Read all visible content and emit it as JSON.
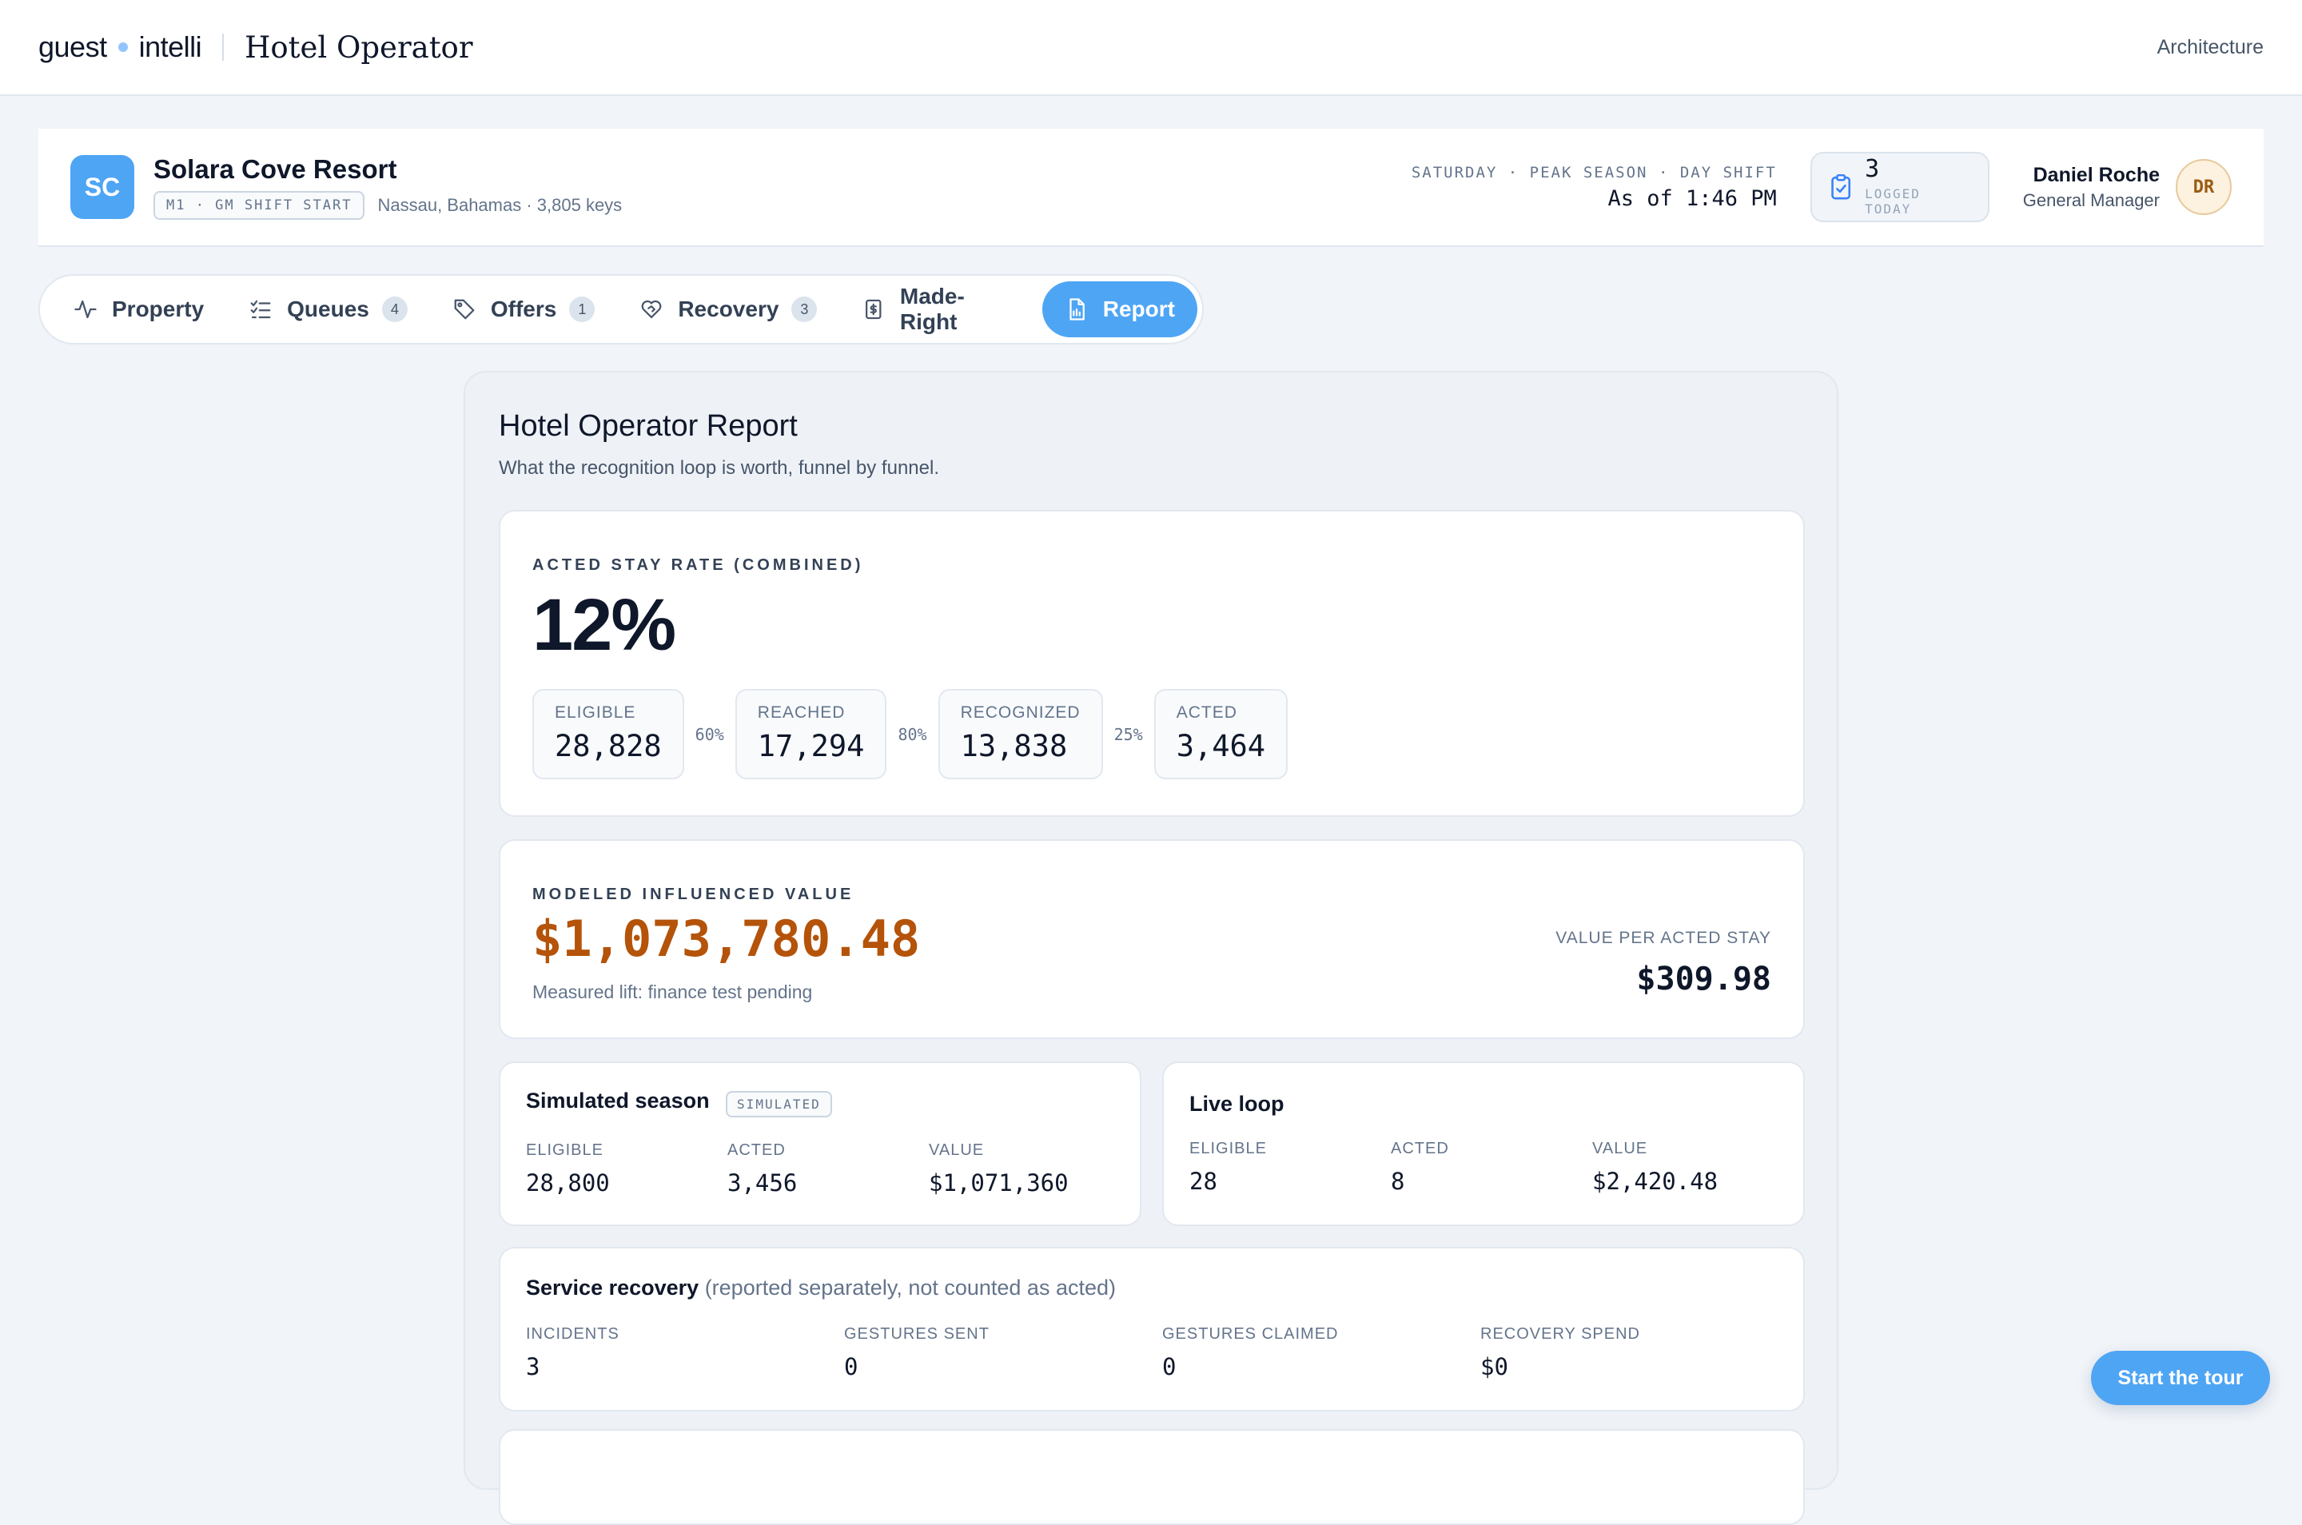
{
  "brand": {
    "part1": "guest",
    "part2": "intelli",
    "product": "Hotel Operator"
  },
  "top_nav": {
    "architecture": "Architecture"
  },
  "property": {
    "initials": "SC",
    "name": "Solara Cove Resort",
    "shift_badge": "M1 · GM SHIFT START",
    "location": "Nassau, Bahamas · 3,805 keys",
    "shift_line": "SATURDAY · PEAK SEASON · DAY SHIFT",
    "as_of": "As of 1:46 PM",
    "logged_count": "3",
    "logged_label": "LOGGED TODAY",
    "user_name": "Daniel Roche",
    "user_role": "General Manager",
    "user_initials": "DR"
  },
  "tabs": [
    {
      "label": "Property",
      "icon": "activity-icon"
    },
    {
      "label": "Queues",
      "count": "4",
      "icon": "checklist-icon"
    },
    {
      "label": "Offers",
      "count": "1",
      "icon": "tag-icon"
    },
    {
      "label": "Recovery",
      "count": "3",
      "icon": "heart-handshake-icon"
    },
    {
      "label": "Made-Right",
      "icon": "receipt-icon"
    },
    {
      "label": "Report",
      "icon": "file-chart-icon",
      "active": true
    }
  ],
  "report": {
    "title": "Hotel Operator Report",
    "subtitle": "What the recognition loop is worth, funnel by funnel.",
    "acted_rate": {
      "label": "ACTED STAY RATE (COMBINED)",
      "value": "12%",
      "funnel": [
        {
          "label": "ELIGIBLE",
          "value": "28,828"
        },
        {
          "label": "REACHED",
          "value": "17,294"
        },
        {
          "label": "RECOGNIZED",
          "value": "13,838"
        },
        {
          "label": "ACTED",
          "value": "3,464"
        }
      ],
      "conversions": [
        "60%",
        "80%",
        "25%"
      ]
    },
    "influenced": {
      "label": "MODELED INFLUENCED VALUE",
      "value": "$1,073,780.48",
      "note": "Measured lift: finance test pending",
      "per_stay_label": "VALUE PER ACTED STAY",
      "per_stay_value": "$309.98"
    },
    "simulated": {
      "title": "Simulated season",
      "badge": "SIMULATED",
      "stats": [
        {
          "label": "ELIGIBLE",
          "value": "28,800"
        },
        {
          "label": "ACTED",
          "value": "3,456"
        },
        {
          "label": "VALUE",
          "value": "$1,071,360"
        }
      ]
    },
    "live": {
      "title": "Live loop",
      "stats": [
        {
          "label": "ELIGIBLE",
          "value": "28"
        },
        {
          "label": "ACTED",
          "value": "8"
        },
        {
          "label": "VALUE",
          "value": "$2,420.48"
        }
      ]
    },
    "service_recovery": {
      "title": "Service recovery",
      "note": "(reported separately, not counted as acted)",
      "stats": [
        {
          "label": "INCIDENTS",
          "value": "3"
        },
        {
          "label": "GESTURES SENT",
          "value": "0"
        },
        {
          "label": "GESTURES CLAIMED",
          "value": "0"
        },
        {
          "label": "RECOVERY SPEND",
          "value": "$0"
        }
      ]
    }
  },
  "tour_button": "Start the tour",
  "colors": {
    "accent": "#4ea5f4",
    "money": "#b45309",
    "background": "#f1f4f8"
  }
}
